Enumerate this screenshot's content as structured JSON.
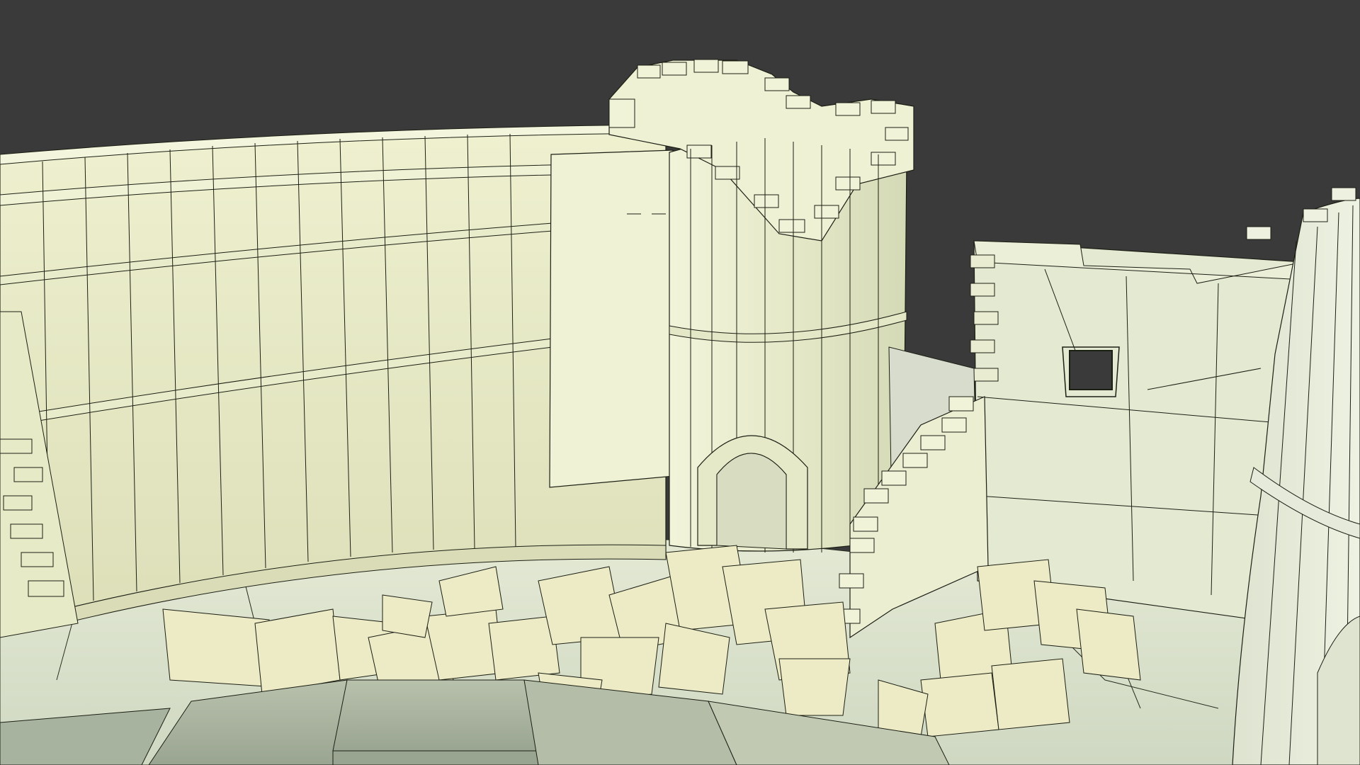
{
  "viewport": {
    "background_color": "#3a3a3a",
    "render_mode": "wireframe-on-shaded",
    "model_base_color": "#e6e8c4",
    "model_shade_color": "#b9bc98",
    "ground_color": "#d8dec6",
    "rubble_color": "#ecebc6",
    "foreground_block_color": "#a9b39f",
    "edge_color": "#1c1f14"
  }
}
